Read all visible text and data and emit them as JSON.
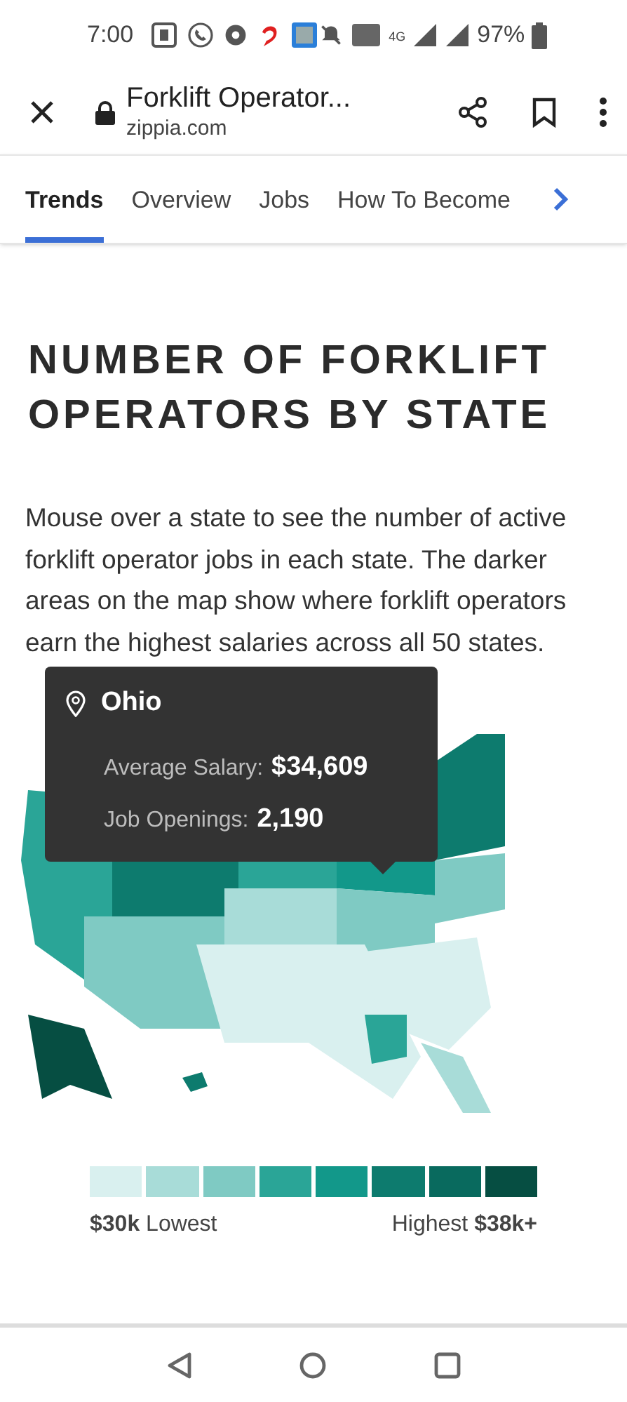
{
  "status_bar": {
    "time": "7:00",
    "battery": "97%",
    "network": "4G"
  },
  "browser": {
    "title": "Forklift Operator...",
    "domain": "zippia.com"
  },
  "tabs": [
    {
      "label": "Trends",
      "selected": true
    },
    {
      "label": "Overview",
      "selected": false
    },
    {
      "label": "Jobs",
      "selected": false
    },
    {
      "label": "How To Become",
      "selected": false
    }
  ],
  "heading": "NUMBER OF FORKLIFT OPERATORS BY STATE",
  "description": "Mouse over a state to see the number of active forklift operator jobs in each state. The darker areas on the map show where forklift operators earn the highest salaries across all 50 states.",
  "tooltip": {
    "state": "Ohio",
    "rows": [
      {
        "label": "Average Salary:",
        "value": "$34,609"
      },
      {
        "label": "Job Openings:",
        "value": "2,190"
      }
    ]
  },
  "legend": {
    "swatches": [
      {
        "color": "#d9f0ef"
      },
      {
        "color": "#a8dcd8"
      },
      {
        "color": "#7fcac3"
      },
      {
        "color": "#2aa597"
      },
      {
        "color": "#12988a"
      },
      {
        "color": "#0d7b6e"
      },
      {
        "color": "#096a5e"
      },
      {
        "color": "#064e42"
      }
    ],
    "low": "**$30k** Lowest",
    "high": "Highest **$38k+**"
  }
}
